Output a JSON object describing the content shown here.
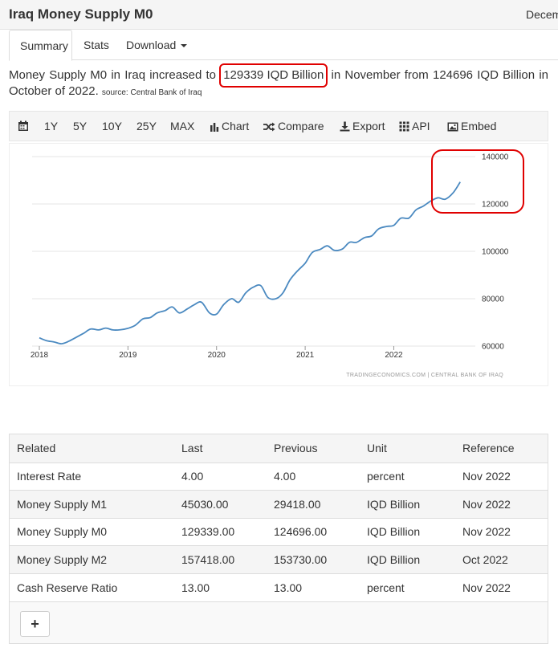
{
  "header": {
    "title": "Iraq Money Supply M0",
    "right_text": "December"
  },
  "tabs": [
    {
      "label": "Summary"
    },
    {
      "label": "Stats"
    },
    {
      "label": "Download"
    }
  ],
  "summary": {
    "before": "Money Supply M0 in Iraq increased to ",
    "value": "129339 IQD Billion",
    "after": " in November from 124696 IQD Billion in October of 2022. ",
    "source": "source: Central Bank of Iraq"
  },
  "toolbar": {
    "ranges": [
      "1Y",
      "5Y",
      "10Y",
      "25Y",
      "MAX"
    ],
    "chart_label": "Chart",
    "compare_label": "Compare",
    "export_label": "Export",
    "api_label": "API",
    "embed_label": "Embed"
  },
  "colors": {
    "line": "#4a89c0",
    "highlight": "#e00000",
    "grid": "#e6e6e6"
  },
  "chart_data": {
    "type": "line",
    "x_ticks": [
      "2018",
      "2019",
      "2020",
      "2021",
      "2022"
    ],
    "y_ticks": [
      "140000",
      "120000",
      "100000",
      "80000",
      "60000"
    ],
    "ylim": [
      60000,
      140000
    ],
    "xlim": [
      2018.0,
      2022.92
    ],
    "grid": true,
    "watermark": "TRADINGECONOMICS.COM | CENTRAL BANK OF IRAQ",
    "x": [
      2018.0,
      2018.08,
      2018.17,
      2018.25,
      2018.33,
      2018.42,
      2018.5,
      2018.58,
      2018.67,
      2018.75,
      2018.83,
      2018.92,
      2019.0,
      2019.08,
      2019.17,
      2019.25,
      2019.33,
      2019.42,
      2019.5,
      2019.58,
      2019.67,
      2019.75,
      2019.83,
      2019.92,
      2020.0,
      2020.08,
      2020.17,
      2020.25,
      2020.33,
      2020.42,
      2020.5,
      2020.58,
      2020.67,
      2020.75,
      2020.83,
      2020.92,
      2021.0,
      2021.08,
      2021.17,
      2021.25,
      2021.33,
      2021.42,
      2021.5,
      2021.58,
      2021.67,
      2021.75,
      2021.83,
      2021.92,
      2022.0,
      2022.08,
      2022.17,
      2022.25,
      2022.33,
      2022.42,
      2022.5,
      2022.58,
      2022.67,
      2022.75,
      2022.83,
      2022.92
    ],
    "values": [
      63500,
      62300,
      61700,
      61000,
      62000,
      63800,
      65400,
      67200,
      66800,
      67600,
      66800,
      66900,
      67500,
      68700,
      71500,
      72000,
      74000,
      75000,
      76500,
      74000,
      75700,
      77500,
      78500,
      74000,
      73500,
      77500,
      80000,
      78500,
      82500,
      85000,
      85500,
      80500,
      80000,
      82500,
      88000,
      92000,
      95000,
      99500,
      100800,
      102300,
      100400,
      101000,
      103800,
      103800,
      105800,
      106500,
      109500,
      110500,
      111000,
      114000,
      114000,
      117500,
      119000,
      121300,
      122600,
      122000,
      124700,
      129300
    ]
  },
  "table": {
    "headers": [
      "Related",
      "Last",
      "Previous",
      "Unit",
      "Reference"
    ],
    "rows": [
      [
        "Interest Rate",
        "4.00",
        "4.00",
        "percent",
        "Nov 2022"
      ],
      [
        "Money Supply M1",
        "45030.00",
        "29418.00",
        "IQD Billion",
        "Nov 2022"
      ],
      [
        "Money Supply M0",
        "129339.00",
        "124696.00",
        "IQD Billion",
        "Nov 2022"
      ],
      [
        "Money Supply M2",
        "157418.00",
        "153730.00",
        "IQD Billion",
        "Oct 2022"
      ],
      [
        "Cash Reserve Ratio",
        "13.00",
        "13.00",
        "percent",
        "Nov 2022"
      ]
    ],
    "add_label": "+"
  }
}
